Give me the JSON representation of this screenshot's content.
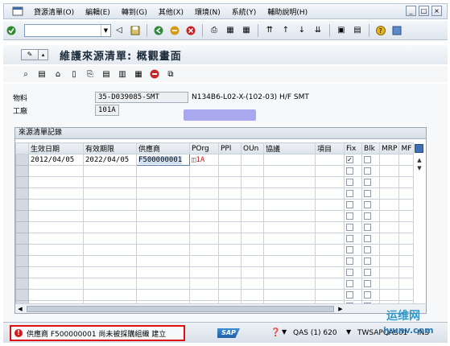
{
  "menu": {
    "items": [
      "貸源清單(O)",
      "編輯(E)",
      "轉到(G)",
      "其他(X)",
      "環境(N)",
      "系統(Y)",
      "輔助說明(H)"
    ]
  },
  "window": {
    "minimize": "_",
    "restore": "□",
    "close": "×"
  },
  "title": "維護來源清單: 概觀畫面",
  "fields": {
    "material_label": "物料",
    "material_value": "35-D039085-SMT",
    "material_desc": "N134B6-L02-X-(102-03) H/F SMT",
    "plant_label": "工廠",
    "plant_value": "101A"
  },
  "table": {
    "group_title": "來源清單記錄",
    "columns": [
      "生效日期",
      "有效期限",
      "供應商",
      "POrg",
      "PPl",
      "OUn",
      "協議",
      "項目",
      "Fix",
      "Blk",
      "MRP",
      "MF"
    ],
    "rows": [
      {
        "valid_from": "2012/04/05",
        "valid_to": "2022/04/05",
        "vendor": "F500000001",
        "porg": "1A",
        "fix": "✓"
      }
    ],
    "empty_rows": 13
  },
  "status": {
    "message": "供應商 F500000001 尚未被採購組織  建立",
    "system": "QAS (1) 620",
    "server": "TWSAPQAS01",
    "ins": "INS"
  },
  "watermark": {
    "line1": "运维网",
    "line2": "iyunv.com"
  },
  "colors": {
    "error": "#d31b1b",
    "title": "#1c2b3a",
    "sap_blue": "#1e5fa8"
  }
}
